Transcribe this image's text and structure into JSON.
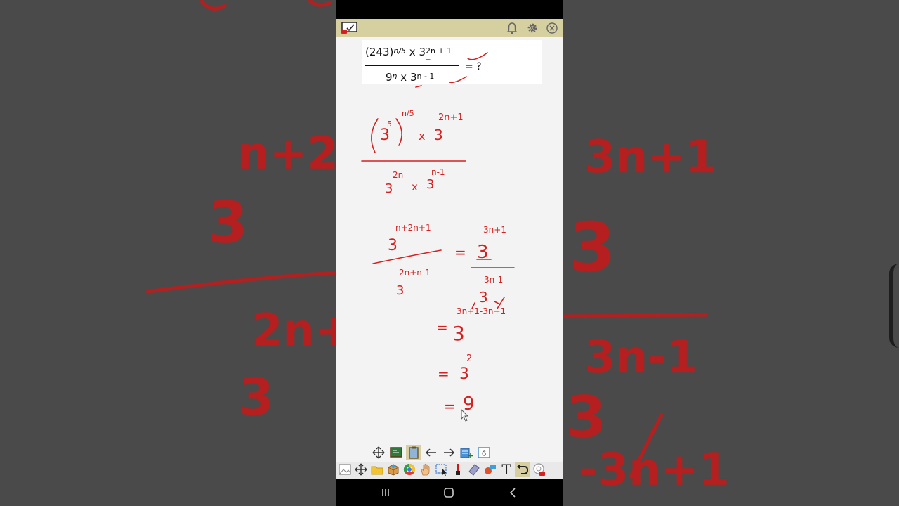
{
  "colors": {
    "ink": "#d42020",
    "app_bar": "#d6cfa0",
    "board": "#f3f3f3",
    "backdrop": "#4a4a4a"
  },
  "app_bar": {
    "icons": [
      "whiteboard-logo-icon",
      "bell-icon",
      "gear-icon",
      "close-icon"
    ]
  },
  "question": {
    "numerator": {
      "base": "(243)",
      "exp1": "n/5",
      "mid": " x 3",
      "exp2": "2n + 1"
    },
    "denominator": {
      "base": "9",
      "exp1": "n",
      "mid": " x 3",
      "exp2": "n - 1"
    },
    "equals": "= ?"
  },
  "work": {
    "step1_num_base1": "3",
    "step1_num_exp_inner": "5",
    "step1_num_exp_outer": "n/5",
    "step1_num_times": "x",
    "step1_num_base2": "3",
    "step1_num_exp2": "2n+1",
    "step1_den_base1": "3",
    "step1_den_exp1": "2n",
    "step1_den_times": "x",
    "step1_den_base2": "3",
    "step1_den_exp2": "n-1",
    "step2_num_base": "3",
    "step2_num_exp": "n+2n+1",
    "step2_den_base": "3",
    "step2_den_exp": "2n+n-1",
    "step2_equals": "=",
    "step2b_num_base": "3",
    "step2b_num_exp": "3n+1",
    "step2b_den_base": "3",
    "step2b_den_exp": "3n-1",
    "step3_exp": "3n+1-3n+1",
    "step3_base": "3",
    "step3_equals": "=",
    "step4_equals": "=",
    "step4_base": "3",
    "step4_exp": "2",
    "step5_equals": "=",
    "step5_result": "9"
  },
  "background_work": {
    "left_top_exp": "n+2",
    "left_base": "3",
    "left_den_exp": "2n+",
    "left_den_base": "3",
    "right_top_exp": "3n+1",
    "right_base": "3",
    "right_den_exp": "3n-1",
    "right_den_base": "3",
    "right_bottom": "-3n+1"
  },
  "toolbar_top": [
    "move-icon",
    "board-icon",
    "clipboard-icon",
    "arrow-left-icon",
    "arrow-right-icon",
    "add-page-icon",
    "page-number-icon"
  ],
  "page_number": "6",
  "toolbar_bottom": [
    "image-icon",
    "move-icon",
    "folder-icon",
    "box-icon",
    "browser-icon",
    "hand-icon",
    "select-icon",
    "pen-icon",
    "eraser-icon",
    "shapes-icon",
    "text-icon",
    "undo-icon",
    "record-icon"
  ],
  "text_tool_label": "T",
  "nav": [
    "recent-apps-icon",
    "home-icon",
    "back-icon"
  ]
}
